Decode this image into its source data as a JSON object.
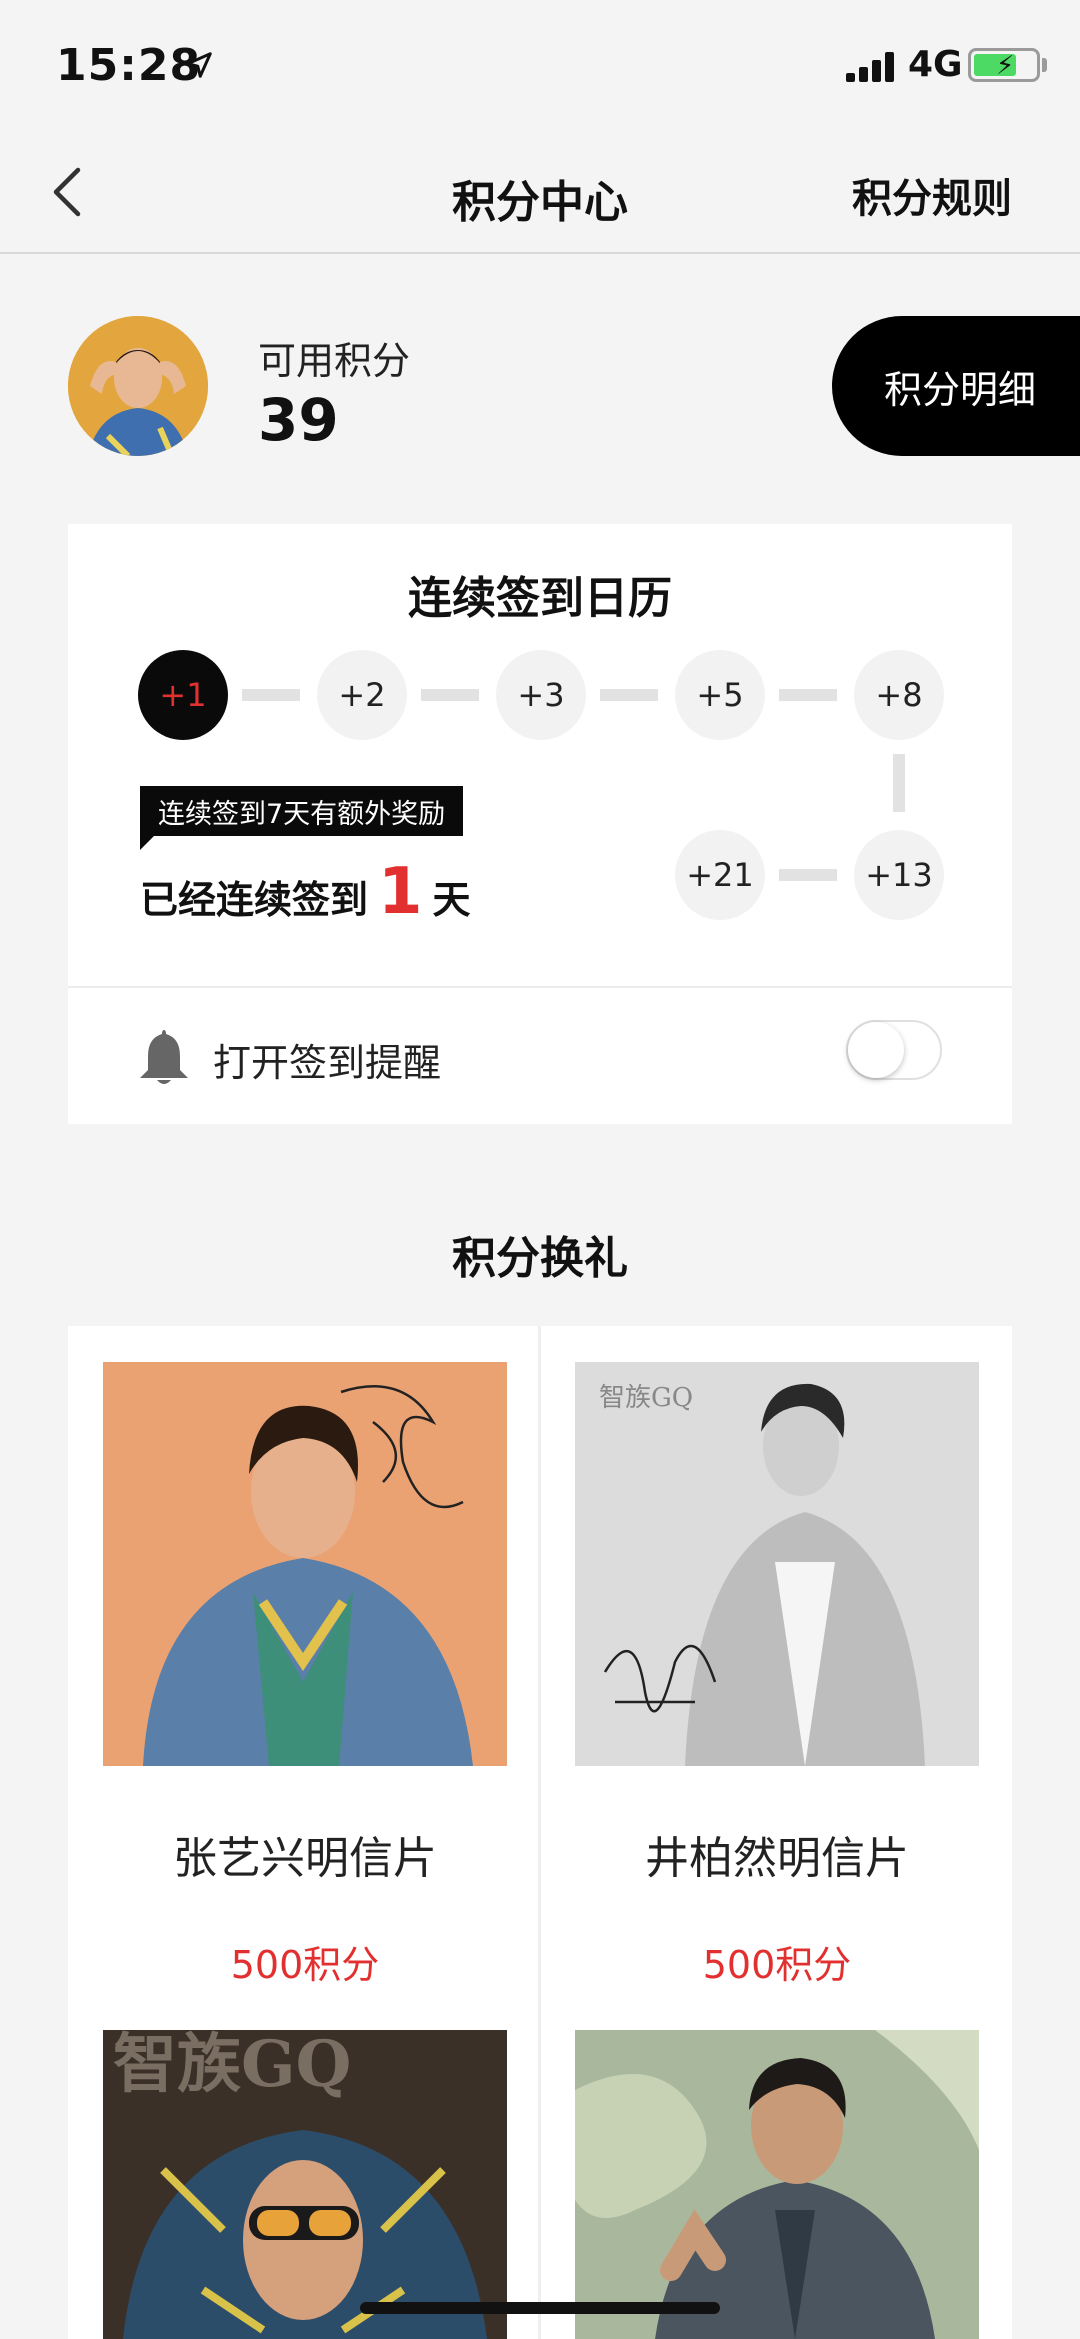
{
  "status_bar": {
    "time": "15:28",
    "network": "4G",
    "battery_level": 0.7
  },
  "nav": {
    "title": "积分中心",
    "right_action": "积分规则"
  },
  "points": {
    "label": "可用积分",
    "value": "39",
    "detail_button": "积分明细"
  },
  "checkin": {
    "title": "连续签到日历",
    "days": [
      "+1",
      "+2",
      "+3",
      "+5",
      "+8",
      "+13",
      "+21"
    ],
    "active_day_index": 0,
    "tip": "连续签到7天有额外奖励",
    "streak_prefix": "已经连续签到",
    "streak_count": "1",
    "streak_suffix": "天",
    "reminder_label": "打开签到提醒",
    "reminder_on": false
  },
  "exchange": {
    "title": "积分换礼",
    "items": [
      {
        "name": "张艺兴明信片",
        "price": "500积分"
      },
      {
        "name": "井柏然明信片",
        "price": "500积分"
      },
      {
        "name": "",
        "price": ""
      },
      {
        "name": "",
        "price": ""
      }
    ],
    "magazine_logo": "智族GQ"
  },
  "colors": {
    "accent_red": "#e23030",
    "black": "#0a0a0a",
    "background": "#f4f4f4"
  }
}
